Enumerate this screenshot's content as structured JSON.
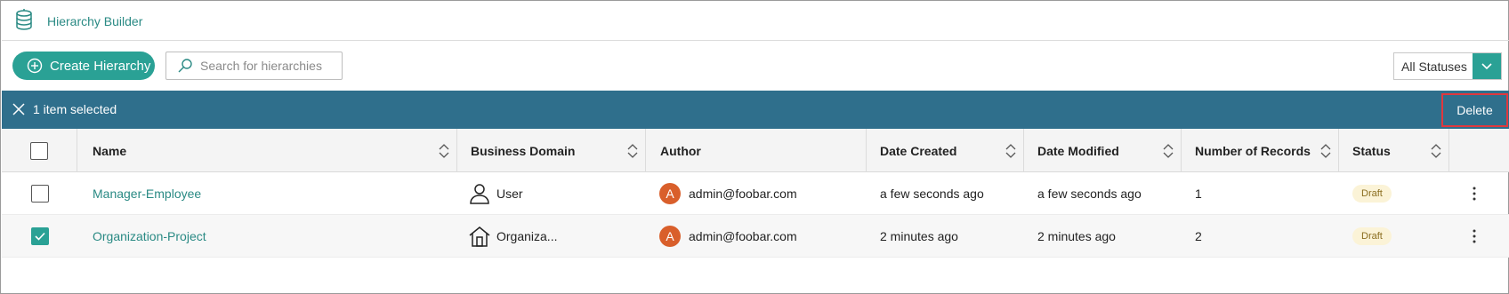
{
  "app": {
    "title": "Hierarchy Builder",
    "logo_icon": "database-icon"
  },
  "toolbar": {
    "create_label": "Create Hierarchy",
    "search_placeholder": "Search for hierarchies",
    "search_value": "",
    "status_filter": "All Statuses"
  },
  "selection": {
    "text": "1 item selected",
    "delete_label": "Delete"
  },
  "table": {
    "columns": [
      "Name",
      "Business Domain",
      "Author",
      "Date Created",
      "Date Modified",
      "Number of Records",
      "Status"
    ],
    "rows": [
      {
        "selected": false,
        "name": "Manager-Employee",
        "domain": "User",
        "domain_icon": "user-icon",
        "author_initial": "A",
        "author": "admin@foobar.com",
        "created": "a few seconds ago",
        "modified": "a few seconds ago",
        "records": "1",
        "status": "Draft"
      },
      {
        "selected": true,
        "name": "Organization-Project",
        "domain": "Organiza...",
        "domain_icon": "building-icon",
        "author_initial": "A",
        "author": "admin@foobar.com",
        "created": "2 minutes ago",
        "modified": "2 minutes ago",
        "records": "2",
        "status": "Draft"
      }
    ]
  },
  "colors": {
    "accent": "#2aa195",
    "selection_bar": "#2f6f8c",
    "avatar": "#d95f2b",
    "highlight": "#e0383e"
  }
}
